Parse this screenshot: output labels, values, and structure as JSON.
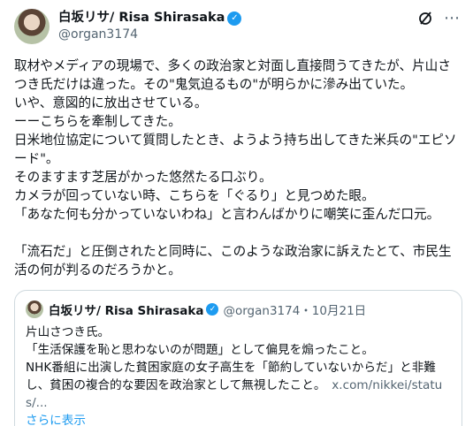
{
  "author": {
    "name": "白坂リサ/ Risa Shirasaka",
    "handle": "@organ3174"
  },
  "tweet": {
    "text": "取材やメディアの現場で、多くの政治家と対面し直接問うてきたが、片山さつき氏だけは違った。その\"鬼気迫るもの\"が明らかに滲み出ていた。\nいや、意図的に放出させている。\nーーこちらを牽制してきた。\n日米地位協定について質問したとき、ようよう持ち出してきた米兵の\"エピソード\"。\nそのますます芝居がかった悠然たる口ぶり。\nカメラが回っていない時、こちらを「ぐるり」と見つめた眼。\n「あなた何も分かっていないわね」と言わんばかりに嘲笑に歪んだ口元。\n\n「流石だ」と圧倒されたと同時に、このような政治家に訴えたとて、市民生活の何が判るのだろうかと。"
  },
  "quote": {
    "name": "白坂リサ/ Risa Shirasaka",
    "handle_date": "@organ3174・10月21日",
    "text": "片山さつき氏。\n「生活保護を恥と思わないのが問題」として偏見を煽ったこと。\nNHK番組に出演した貧困家庭の女子高生を「節約していないからだ」と非難し、貧困の複合的な要因を政治家として無視したこと。",
    "link": "x.com/nikkei/status/...",
    "show_more": "さらに表示"
  },
  "icons": {
    "verified": "verified-badge-icon",
    "grok": "grok-icon",
    "more": "more-options-icon"
  },
  "colors": {
    "accent": "#1d9bf0",
    "secondary_text": "#536471",
    "border": "#cfd9de"
  }
}
